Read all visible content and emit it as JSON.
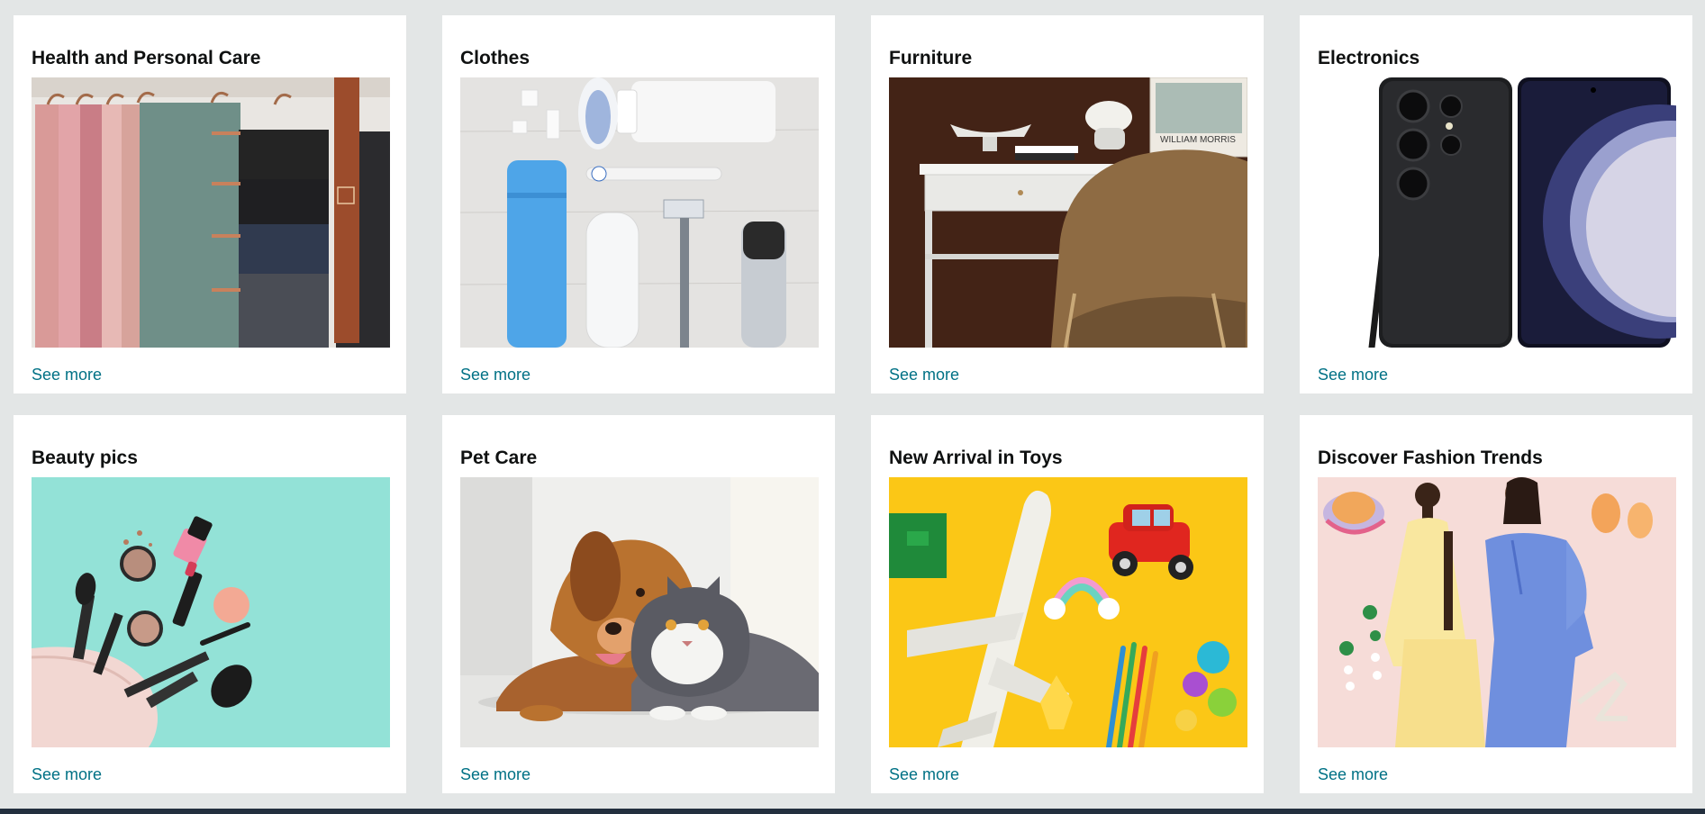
{
  "cards": [
    {
      "title": "Health and Personal Care",
      "image_icon": "clothes-hangers-image",
      "link_label": "See more"
    },
    {
      "title": "Clothes",
      "image_icon": "toiletries-image",
      "link_label": "See more"
    },
    {
      "title": "Furniture",
      "image_icon": "desk-and-chair-image",
      "link_label": "See more",
      "image_caption": "WILLIAM MORRIS"
    },
    {
      "title": "Electronics",
      "image_icon": "smartphone-image",
      "link_label": "See more"
    },
    {
      "title": "Beauty pics",
      "image_icon": "makeup-bag-image",
      "link_label": "See more"
    },
    {
      "title": "Pet Care",
      "image_icon": "dog-and-cat-image",
      "link_label": "See more"
    },
    {
      "title": "New Arrival in Toys",
      "image_icon": "toys-image",
      "link_label": "See more"
    },
    {
      "title": "Discover Fashion Trends",
      "image_icon": "fashion-models-image",
      "link_label": "See more"
    }
  ],
  "colors": {
    "page_background": "#e3e6e6",
    "card_background": "#ffffff",
    "title_text": "#0f1111",
    "link_text": "#007185"
  }
}
